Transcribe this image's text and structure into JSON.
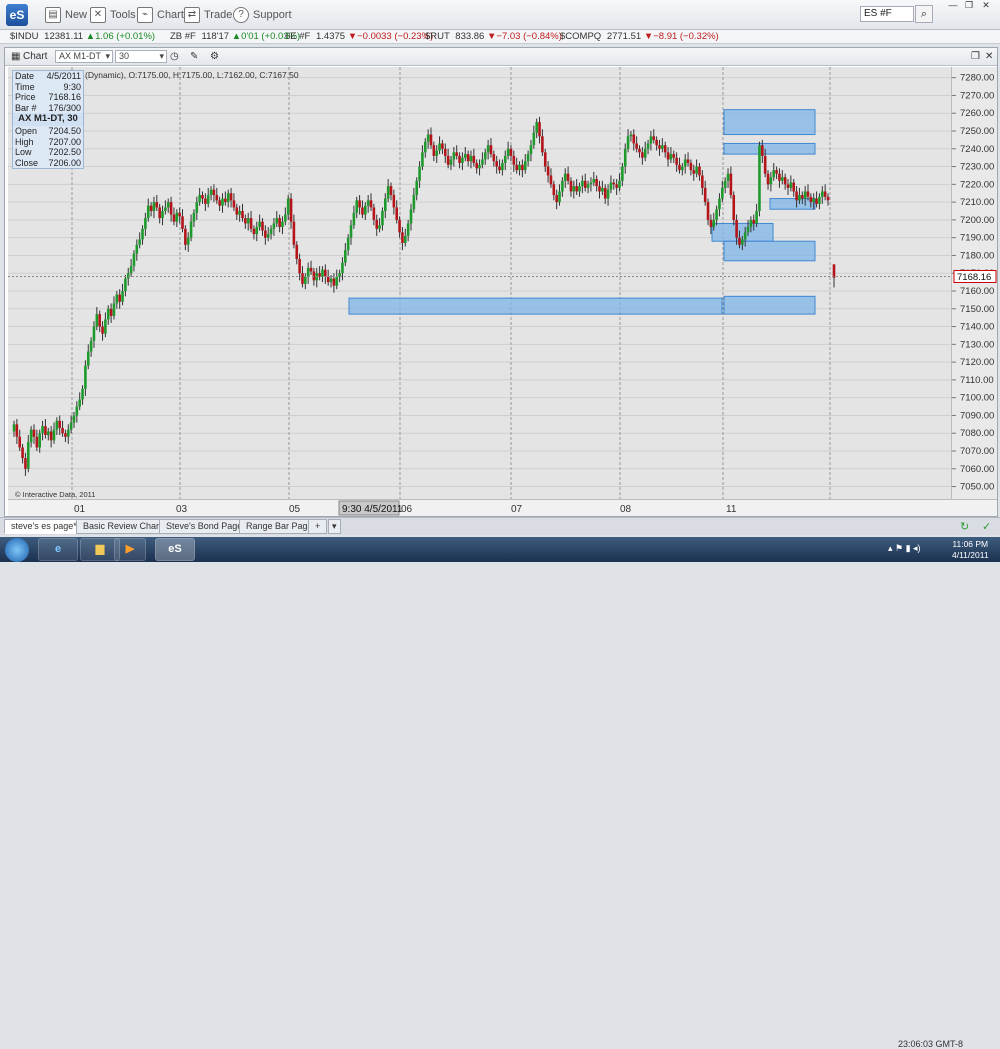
{
  "app": {
    "logo": "eS"
  },
  "toolbar": {
    "buttons": [
      {
        "label": "New",
        "icon": "new-icon"
      },
      {
        "label": "Tools",
        "icon": "tools-icon"
      },
      {
        "label": "Chart",
        "icon": "chart-icon"
      },
      {
        "label": "Trade",
        "icon": "trade-icon"
      },
      {
        "label": "Support",
        "icon": "support-icon"
      }
    ],
    "symbol_value": "ES #F"
  },
  "ticker": [
    {
      "sym": "$INDU",
      "val": "12381.11",
      "chg": "1.06 (+0.01%)",
      "dir": "up"
    },
    {
      "sym": "ZB #F",
      "val": "118'17",
      "chg": "0'01 (+0.03%)",
      "dir": "up"
    },
    {
      "sym": "6E #F",
      "val": "1.4375",
      "chg": "−0.0033 (−0.23%)",
      "dir": "dn"
    },
    {
      "sym": "$RUT",
      "val": "833.86",
      "chg": "−7.03 (−0.84%)",
      "dir": "dn"
    },
    {
      "sym": "$COMPQ",
      "val": "2771.51",
      "chg": "−8.91 (−0.32%)",
      "dir": "dn"
    }
  ],
  "chart_window": {
    "title": "Chart",
    "symbol": "AX M1-DT",
    "interval": "30",
    "ohlc_header": "(Dynamic), O:7175.00, H:7175.00, L:7162.00, C:7167.50",
    "info": {
      "date_label": "Date",
      "date": "4/5/2011",
      "time_label": "Time",
      "time": "9:30",
      "price_label": "Price",
      "price": "7168.16",
      "bar_label": "Bar #",
      "bar": "176/300",
      "heading": "AX M1-DT, 30",
      "open_label": "Open",
      "open": "7204.50",
      "high_label": "High",
      "high": "7207.00",
      "low_label": "Low",
      "low": "7202.50",
      "close_label": "Close",
      "close": "7206.00"
    },
    "copyright": "© Interactive Data, 2011",
    "last_price": "7168.16"
  },
  "chart_data": {
    "type": "candlestick",
    "ylim": [
      7043,
      7286
    ],
    "y_ticks": [
      7050,
      7060,
      7070,
      7080,
      7090,
      7100,
      7110,
      7120,
      7130,
      7140,
      7150,
      7160,
      7170,
      7180,
      7190,
      7200,
      7210,
      7220,
      7230,
      7240,
      7250,
      7260,
      7270,
      7280
    ],
    "x_ticks": [
      "01",
      "03",
      "05",
      "06",
      "07",
      "08",
      "11"
    ],
    "cursor_label": "9:30 4/5/2011",
    "closes": [
      7085,
      7078,
      7072,
      7066,
      7060,
      7075,
      7082,
      7078,
      7072,
      7080,
      7084,
      7079,
      7081,
      7076,
      7082,
      7087,
      7083,
      7080,
      7078,
      7082,
      7086,
      7090,
      7095,
      7099,
      7105,
      7118,
      7126,
      7132,
      7140,
      7147,
      7140,
      7136,
      7144,
      7150,
      7146,
      7153,
      7158,
      7154,
      7160,
      7167,
      7170,
      7174,
      7181,
      7186,
      7189,
      7195,
      7201,
      7208,
      7205,
      7210,
      7207,
      7201,
      7205,
      7207,
      7210,
      7203,
      7199,
      7204,
      7202,
      7195,
      7186,
      7190,
      7199,
      7204,
      7210,
      7214,
      7212,
      7209,
      7214,
      7217,
      7214,
      7211,
      7208,
      7212,
      7210,
      7215,
      7211,
      7207,
      7203,
      7205,
      7201,
      7198,
      7201,
      7195,
      7192,
      7196,
      7199,
      7194,
      7190,
      7192,
      7195,
      7198,
      7201,
      7196,
      7199,
      7203,
      7212,
      7199,
      7186,
      7178,
      7170,
      7164,
      7168,
      7173,
      7171,
      7166,
      7170,
      7168,
      7172,
      7168,
      7165,
      7167,
      7163,
      7168,
      7170,
      7176,
      7183,
      7190,
      7197,
      7204,
      7211,
      7207,
      7203,
      7208,
      7211,
      7207,
      7200,
      7195,
      7197,
      7205,
      7212,
      7219,
      7214,
      7207,
      7200,
      7193,
      7187,
      7191,
      7198,
      7206,
      7214,
      7222,
      7230,
      7238,
      7244,
      7248,
      7242,
      7236,
      7239,
      7243,
      7240,
      7236,
      7231,
      7234,
      7238,
      7236,
      7232,
      7235,
      7237,
      7233,
      7236,
      7232,
      7229,
      7231,
      7234,
      7238,
      7242,
      7237,
      7233,
      7230,
      7228,
      7232,
      7236,
      7240,
      7236,
      7231,
      7228,
      7231,
      7228,
      7233,
      7237,
      7242,
      7249,
      7255,
      7247,
      7238,
      7230,
      7225,
      7220,
      7214,
      7210,
      7216,
      7222,
      7226,
      7222,
      7216,
      7219,
      7216,
      7219,
      7222,
      7218,
      7220,
      7221,
      7223,
      7219,
      7216,
      7218,
      7212,
      7217,
      7221,
      7220,
      7218,
      7222,
      7230,
      7240,
      7247,
      7248,
      7243,
      7240,
      7238,
      7235,
      7240,
      7243,
      7247,
      7245,
      7242,
      7240,
      7242,
      7238,
      7234,
      7237,
      7235,
      7231,
      7228,
      7230,
      7234,
      7232,
      7228,
      7226,
      7230,
      7225,
      7218,
      7210,
      7200,
      7196,
      7200,
      7206,
      7212,
      7218,
      7222,
      7226,
      7214,
      7200,
      7190,
      7186,
      7189,
      7193,
      7196,
      7200,
      7198,
      7205,
      7242,
      7236,
      7226,
      7220,
      7224,
      7228,
      7226,
      7222,
      7224,
      7220,
      7218,
      7221,
      7216,
      7211,
      7214,
      7212,
      7216,
      7213,
      7210,
      7212,
      7209,
      7213,
      7216,
      7213,
      7211
    ],
    "last_close": 7167.5,
    "zones": [
      {
        "y0": 7248,
        "y1": 7262
      },
      {
        "y0": 7237,
        "y1": 7243
      },
      {
        "y0": 7206,
        "y1": 7212
      },
      {
        "y0": 7188,
        "y1": 7198
      },
      {
        "y0": 7177,
        "y1": 7188
      },
      {
        "y0": 7147,
        "y1": 7156
      },
      {
        "y0": 7147,
        "y1": 7157
      }
    ]
  },
  "page_tabs": [
    {
      "label": "steve's es page*"
    },
    {
      "label": "Basic Review Charts"
    },
    {
      "label": "Steve's Bond Page*"
    },
    {
      "label": "Range Bar Page"
    },
    {
      "label": "+"
    }
  ],
  "status_time": "23:06:03 GMT-8",
  "taskbar": {
    "es_label": "eS",
    "time": "11:06 PM",
    "date": "4/11/2011"
  }
}
